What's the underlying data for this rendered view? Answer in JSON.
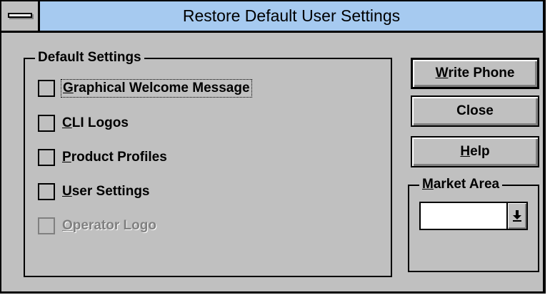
{
  "window": {
    "title": "Restore Default User Settings"
  },
  "default_settings": {
    "label": "Default Settings",
    "items": [
      {
        "mnemonic": "G",
        "rest": "raphical Welcome Message",
        "checked": false,
        "enabled": true,
        "focused": true
      },
      {
        "mnemonic": "C",
        "rest": "LI Logos",
        "checked": false,
        "enabled": true,
        "focused": false
      },
      {
        "mnemonic": "P",
        "rest": "roduct Profiles",
        "checked": false,
        "enabled": true,
        "focused": false
      },
      {
        "mnemonic": "U",
        "rest": "ser Settings",
        "checked": false,
        "enabled": true,
        "focused": false
      },
      {
        "mnemonic": "O",
        "rest": "perator Logo",
        "checked": false,
        "enabled": false,
        "focused": false
      }
    ]
  },
  "buttons": {
    "write_phone": {
      "mnemonic": "W",
      "rest": "rite Phone"
    },
    "close": {
      "label": "Close"
    },
    "help": {
      "mnemonic": "H",
      "rest": "elp"
    }
  },
  "market_area": {
    "mnemonic": "M",
    "rest": "arket Area",
    "value": ""
  }
}
